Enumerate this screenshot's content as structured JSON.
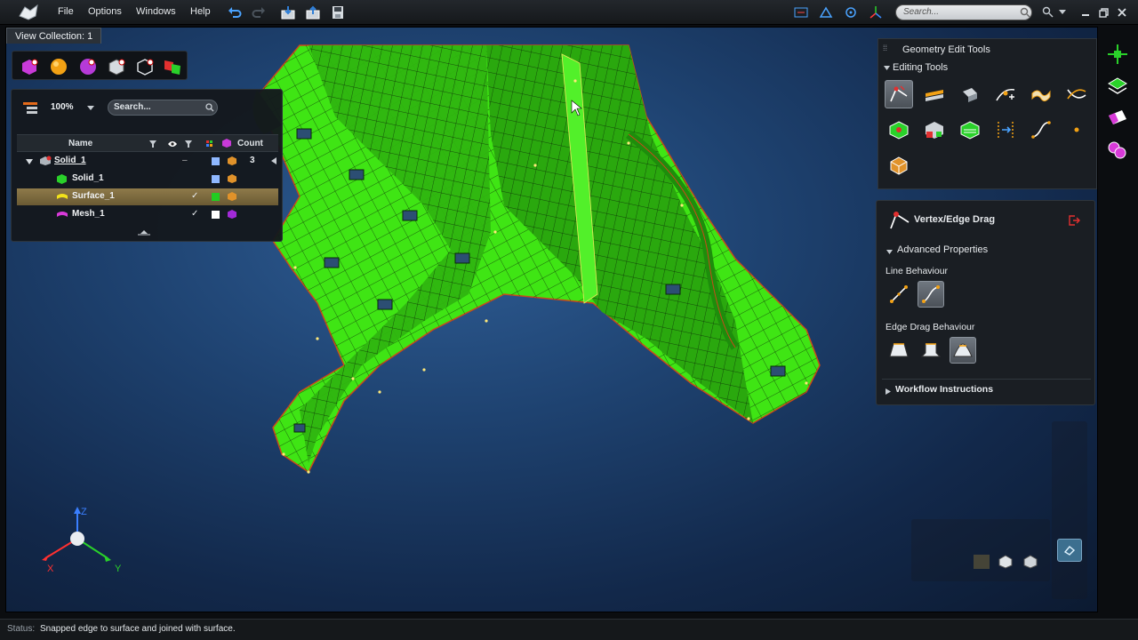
{
  "menubar": {
    "items": [
      "File",
      "Options",
      "Windows",
      "Help"
    ],
    "search_placeholder": "Search..."
  },
  "viewport": {
    "tab_label": "View Collection: 1",
    "axis": {
      "z": "Z",
      "x": "X",
      "y": "Y"
    }
  },
  "tree_panel": {
    "zoom": "100%",
    "search_placeholder": "Search...",
    "headers": {
      "name": "Name",
      "count": "Count"
    },
    "rows": [
      {
        "label": "Solid_1",
        "count": "3",
        "level": 0,
        "swatch": "#8fb8ff"
      },
      {
        "label": "Solid_1",
        "count": "",
        "level": 1,
        "swatch": "#8fb8ff"
      },
      {
        "label": "Surface_1",
        "count": "",
        "level": 1,
        "swatch": "#22cc22",
        "selected": true
      },
      {
        "label": "Mesh_1",
        "count": "",
        "level": 1,
        "swatch": "#ffffff"
      }
    ]
  },
  "geometry_panel": {
    "title": "Geometry Edit Tools",
    "section": "Editing Tools"
  },
  "vertex_panel": {
    "title": "Vertex/Edge Drag",
    "advanced": "Advanced Properties",
    "line_behaviour": "Line Behaviour",
    "edge_drag_behaviour": "Edge Drag Behaviour",
    "workflow": "Workflow Instructions"
  },
  "status": {
    "label": "Status:",
    "text": "Snapped edge to surface and joined with surface."
  },
  "colors": {
    "mesh": "#39e60c",
    "mesh_dark": "#1f9a10",
    "viewport_bg": "#1e4270"
  }
}
